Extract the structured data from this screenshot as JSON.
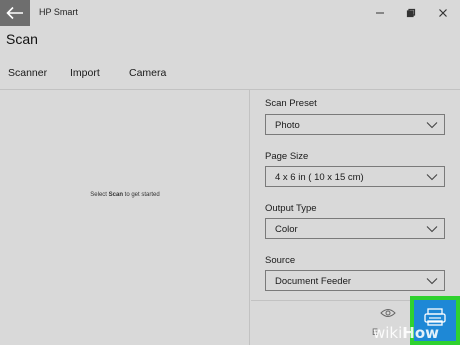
{
  "window": {
    "app_title": "HP Smart",
    "icons": {
      "back": "back-arrow-icon",
      "minimize": "minimize-icon",
      "restore": "restore-icon",
      "close": "close-icon"
    }
  },
  "page": {
    "title": "Scan"
  },
  "tabs": [
    {
      "label": "Scanner",
      "active": true
    },
    {
      "label": "Import",
      "active": false
    },
    {
      "label": "Camera",
      "active": false
    }
  ],
  "preview": {
    "message_prefix": "Select",
    "message_bold": "Scan",
    "message_suffix": "to get started"
  },
  "settings": {
    "scan_preset": {
      "label": "Scan Preset",
      "value": "Photo"
    },
    "page_size": {
      "label": "Page Size",
      "value": "4 x 6 in ( 10 x 15 cm)"
    },
    "output_type": {
      "label": "Output Type",
      "value": "Color"
    },
    "source": {
      "label": "Source",
      "value": "Document Feeder"
    }
  },
  "actions": {
    "preview_label": "E",
    "preview_icon": "eye-icon",
    "scan_icon": "scanner-icon"
  },
  "watermark": {
    "prefix": "wiki",
    "suffix": "How"
  },
  "colors": {
    "background": "#d9d9d9",
    "back_button": "#6e6e6e",
    "scan_button": "#1e88d6",
    "highlight_border": "#2fd12f"
  }
}
